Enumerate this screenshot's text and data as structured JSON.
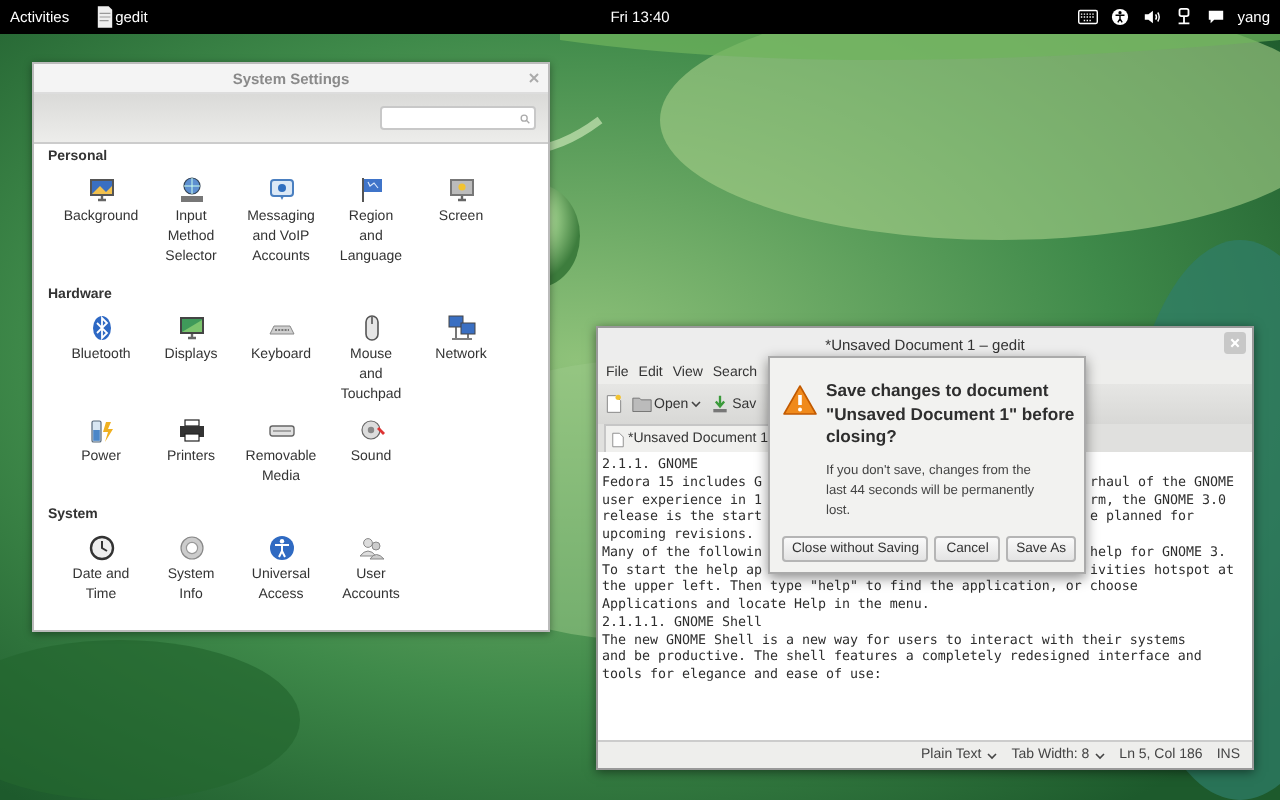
{
  "top_bar": {
    "activities": "Activities",
    "app": "gedit",
    "clock": "Fri 13:40",
    "user": "yang"
  },
  "settings_window": {
    "title": "System Settings",
    "sections": [
      {
        "title": "Personal",
        "items": [
          {
            "label": "Background",
            "kind": "background"
          },
          {
            "label": "Input\nMethod\nSelector",
            "kind": "input-method"
          },
          {
            "label": "Messaging\nand VoIP\nAccounts",
            "kind": "messaging"
          },
          {
            "label": "Region\nand\nLanguage",
            "kind": "region"
          },
          {
            "label": "Screen",
            "kind": "screen"
          }
        ]
      },
      {
        "title": "Hardware",
        "items": [
          {
            "label": "Bluetooth",
            "kind": "bluetooth"
          },
          {
            "label": "Displays",
            "kind": "displays"
          },
          {
            "label": "Keyboard",
            "kind": "keyboard"
          },
          {
            "label": "Mouse\nand\nTouchpad",
            "kind": "mouse"
          },
          {
            "label": "Network",
            "kind": "network"
          },
          {
            "label": "Power",
            "kind": "power"
          },
          {
            "label": "Printers",
            "kind": "printers"
          },
          {
            "label": "Removable\nMedia",
            "kind": "removable"
          },
          {
            "label": "Sound",
            "kind": "sound"
          }
        ]
      },
      {
        "title": "System",
        "items": [
          {
            "label": "Date and\nTime",
            "kind": "datetime"
          },
          {
            "label": "System\nInfo",
            "kind": "info"
          },
          {
            "label": "Universal\nAccess",
            "kind": "access"
          },
          {
            "label": "User\nAccounts",
            "kind": "users"
          }
        ]
      }
    ]
  },
  "gedit_window": {
    "title": "*Unsaved Document 1 – gedit",
    "menu": [
      "File",
      "Edit",
      "View",
      "Search"
    ],
    "toolbar": {
      "open": "Open",
      "save": "Sav"
    },
    "tab": "*Unsaved Document 1",
    "lines": [
      {
        "left": "2.1.1. GNOME"
      },
      {
        "left": "Fedora 15 includes G",
        "right": "rhaul of the GNOME"
      },
      {
        "left": "user experience in 1",
        "right": "rm, the GNOME 3.0"
      },
      {
        "left": "release is the start",
        "right": "e planned for"
      },
      {
        "left": "upcoming revisions."
      },
      {
        "left": "Many of the followin",
        "right": "help for GNOME 3."
      },
      {
        "left": "To start the help ap",
        "right": "ivities hotspot at"
      },
      {
        "left": "the upper left. Then type \"help\" to find the application, or choose"
      },
      {
        "left": "Applications and locate Help in the menu."
      },
      {
        "left": "2.1.1.1. GNOME Shell"
      },
      {
        "left": "The new GNOME Shell is a new way for users to interact with their systems"
      },
      {
        "left": "and be productive. The shell features a completely redesigned interface and"
      },
      {
        "left": "tools for elegance and ease of use:"
      }
    ],
    "status": {
      "language": "Plain Text",
      "tab_width": "Tab Width: 8",
      "position": "Ln 5, Col 186",
      "mode": "INS"
    }
  },
  "dialog": {
    "title": "Save changes to document \"Unsaved Document 1\" before closing?",
    "message": "If you don't save, changes from the last 44 seconds will be permanently lost.",
    "buttons": [
      "Close without Saving",
      "Cancel",
      "Save As"
    ]
  }
}
